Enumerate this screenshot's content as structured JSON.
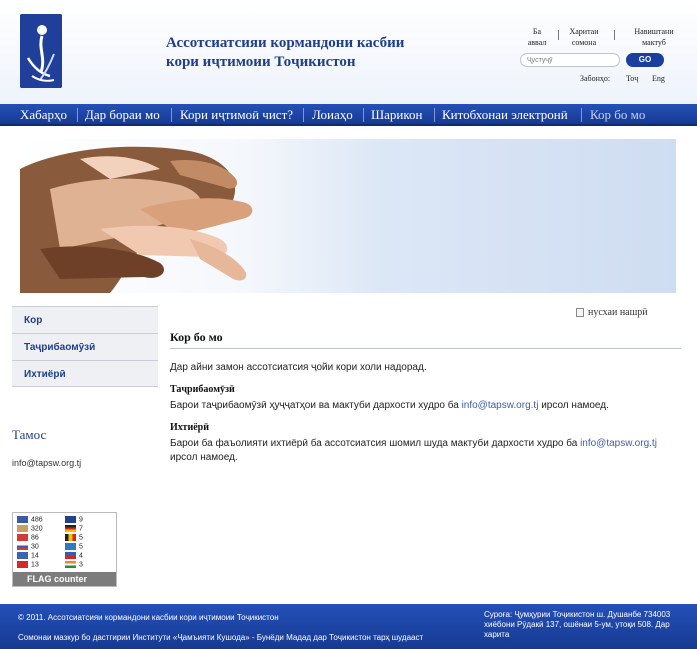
{
  "header": {
    "title_line1": "Ассотсиатсияи кормандони касбии",
    "title_line2": "кори иҷтимоии Тоҷикистон",
    "toplinks": [
      {
        "line1": "Ба",
        "line2": "аввал"
      },
      {
        "line1": "Харитаи",
        "line2": "сомона"
      },
      {
        "line1": "Навиштани",
        "line2": "мактуб"
      }
    ],
    "search_placeholder": "Ҷустуҷӯ",
    "go_label": "GO",
    "lang_label": "Забонҳо:",
    "lang_tj": "Тоҷ",
    "lang_en": "Eng"
  },
  "nav": {
    "items": [
      {
        "label": "Хабарҳо"
      },
      {
        "label": "Дар бораи мо"
      },
      {
        "label": "Кори иҷтимоӣ чист?"
      },
      {
        "label": "Лоиаҳо"
      },
      {
        "label": "Шарикон"
      },
      {
        "label": "Китобхонаи электронӣ"
      },
      {
        "label": "Кор бо мо"
      }
    ]
  },
  "sidebar": {
    "items": [
      {
        "label": "Кор"
      },
      {
        "label": "Таҷрибаомӯзӣ"
      },
      {
        "label": "Ихтиёрӣ"
      }
    ],
    "contact_title": "Тамос",
    "contact_email": "info@tapsw.org.tj"
  },
  "flag_counter": {
    "left": [
      {
        "count": "486",
        "color": "#3c5aa8"
      },
      {
        "count": "320",
        "color": "#c8a060"
      },
      {
        "count": "86",
        "color": "#d23a3a"
      },
      {
        "count": "30",
        "color": "#d03a3a"
      },
      {
        "count": "14",
        "color": "#3a66b0"
      },
      {
        "count": "13",
        "color": "#d62828"
      }
    ],
    "right": [
      {
        "count": "9",
        "color": "#24418c"
      },
      {
        "count": "7",
        "color": "#c88a30"
      },
      {
        "count": "5",
        "color": "#e2b820"
      },
      {
        "count": "5",
        "color": "#2f78c8"
      },
      {
        "count": "4",
        "color": "#3060b8"
      },
      {
        "count": "3",
        "color": "#e88a2a"
      }
    ],
    "brand": "FLAG counter"
  },
  "main": {
    "print_label": "нусхаи нашрӣ",
    "page_title": "Кор бо мо",
    "intro": "Дар айни замон ассотсиатсия ҷойи кори холи надорад.",
    "section1_title": "Таҷрибаомӯзӣ",
    "section1_text": "Барои таҷрибаомӯзӣ ҳуҷҷатҳои ва мактуби дархости худро ба ",
    "section1_email": "info@tapsw.org.tj",
    "section1_suffix": " ирсол намоед.",
    "section2_title": "Ихтиёрӣ",
    "section2_text": "Барои ба фаъолияти ихтиёрӣ ба ассотсиатсия шомил шуда мактуби дархости худро ба ",
    "section2_email": "info@tapsw.org.tj",
    "section2_suffix": " ирсол намоед."
  },
  "footer": {
    "copyright": "© 2011. Ассотсиатсияи кормандони касбии кори иҷтимоии Тоҷикистон",
    "credit": "Сомонаи мазкур бо дастгирии Институти «Ҷамъияти Кушода» - Бунёди Мадад дар Тоҷикистон тарҳ шудааст",
    "address": "Суроға: Ҷумҳурии Тоҷикистон ш. Душанбе 734003 хиёбони Рӯдакӣ 137, ошёнаи 5-ум, утоқи 508. Дар харита"
  }
}
